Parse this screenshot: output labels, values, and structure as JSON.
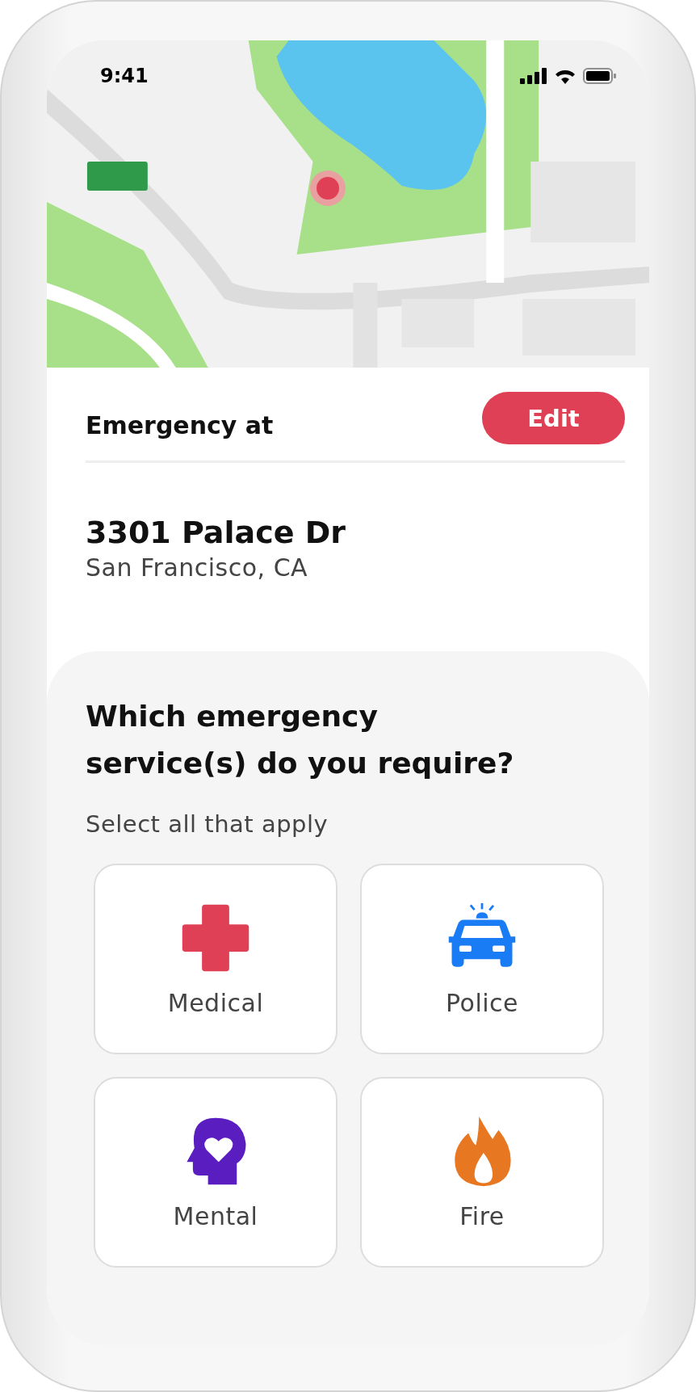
{
  "status_bar": {
    "time": "9:41"
  },
  "location": {
    "label": "Emergency at",
    "edit_button": "Edit",
    "address": "3301 Palace Dr",
    "city": "San Francisco, CA"
  },
  "services": {
    "question": "Which emergency service(s) do you require?",
    "hint": "Select all that apply",
    "options": [
      {
        "kind": "medical",
        "label": "Medical",
        "selected": false
      },
      {
        "kind": "police",
        "label": "Police",
        "selected": false
      },
      {
        "kind": "mental",
        "label": "Mental",
        "selected": false
      },
      {
        "kind": "fire",
        "label": "Fire",
        "selected": false
      }
    ]
  }
}
